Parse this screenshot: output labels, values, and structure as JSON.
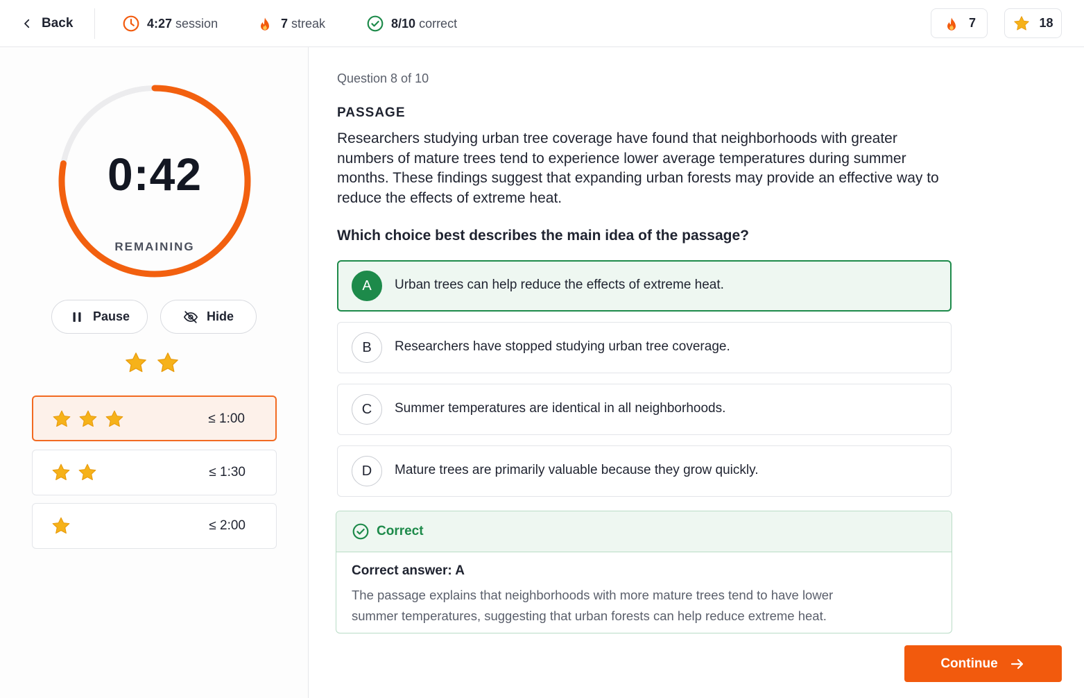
{
  "header": {
    "back_label": "Back",
    "session_time": "4:27",
    "session_label": "session",
    "streak_value": "7",
    "streak_label": "streak",
    "correct_value": "8/10",
    "correct_label": "correct",
    "fire_count": "7",
    "star_count": "18"
  },
  "timer": {
    "value": "0:42",
    "label": "REMAINING",
    "remaining_fraction": 0.78,
    "pause_label": "Pause",
    "hide_label": "Hide",
    "earned_stars": 2
  },
  "tiers": [
    {
      "stars": 3,
      "time": "≤ 1:00",
      "active": true
    },
    {
      "stars": 2,
      "time": "≤ 1:30",
      "active": false
    },
    {
      "stars": 1,
      "time": "≤ 2:00",
      "active": false
    }
  ],
  "question": {
    "counter": "Question 8 of 10",
    "passage_heading": "PASSAGE",
    "passage": "Researchers studying urban tree coverage have found that neighborhoods with greater numbers of mature trees tend to experience lower average temperatures during summer months. These findings suggest that expanding urban forests may provide an effective way to reduce the effects of extreme heat.",
    "prompt": "Which choice best describes the main idea of the passage?",
    "options": [
      {
        "letter": "A",
        "text": "Urban trees can help reduce the effects of extreme heat.",
        "selected": true
      },
      {
        "letter": "B",
        "text": "Researchers have stopped studying urban tree coverage.",
        "selected": false
      },
      {
        "letter": "C",
        "text": "Summer temperatures are identical in all neighborhoods.",
        "selected": false
      },
      {
        "letter": "D",
        "text": "Mature trees are primarily valuable because they grow quickly.",
        "selected": false
      }
    ]
  },
  "feedback": {
    "status": "Correct",
    "answer": "Correct answer: A",
    "explanation": "The passage explains that neighborhoods with more mature trees tend to have lower summer temperatures, suggesting that urban forests can help reduce extreme heat."
  },
  "continue_label": "Continue",
  "colors": {
    "accent": "#f25a0d",
    "correct": "#1d8a4a",
    "star": "#f6b21a"
  }
}
